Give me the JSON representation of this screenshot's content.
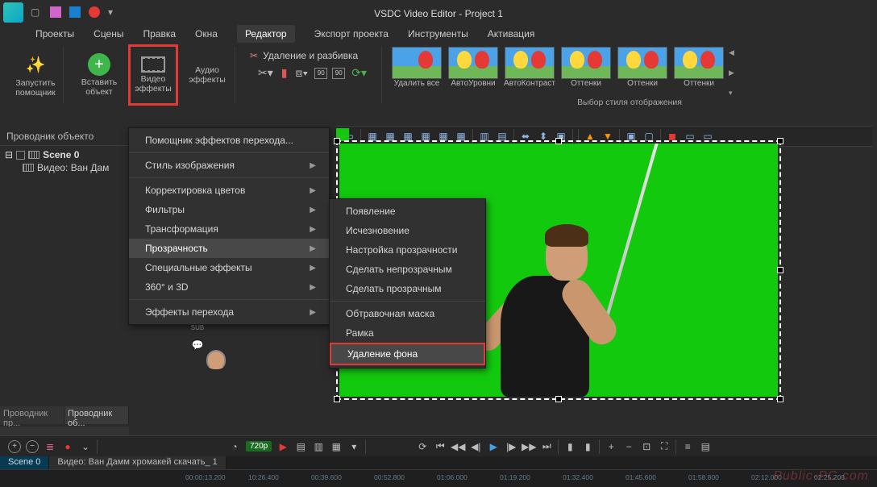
{
  "title": "VSDC Video Editor - Project 1",
  "menubar": [
    "Проекты",
    "Сцены",
    "Правка",
    "Окна",
    "Редактор",
    "Экспорт проекта",
    "Инструменты",
    "Активация"
  ],
  "active_menu_index": 4,
  "ribbon": {
    "run_wizard": "Запустить\nпомощник",
    "insert_object": "Вставить\nобъект",
    "video_effects": "Видео\nэффекты",
    "audio_effects": "Аудио\nэффекты",
    "delete_split": "Удаление и разбивка",
    "gallery_label": "Выбор стиля отображения",
    "thumbs": [
      "Удалить все",
      "АвтоУровни",
      "АвтоКонтраст",
      "Оттенки",
      "Оттенки",
      "Оттенки"
    ]
  },
  "left_panel": {
    "title": "Проводник объекто",
    "scene": "Scene 0",
    "video": "Видео: Ван Дам",
    "tabs": [
      "Проводник пр...",
      "Проводник об..."
    ],
    "active_tab": 1
  },
  "context_menu_1": [
    {
      "label": "Помощник эффектов перехода...",
      "arrow": false
    },
    {
      "sep": true
    },
    {
      "label": "Стиль изображения",
      "arrow": true
    },
    {
      "sep": true
    },
    {
      "label": "Корректировка цветов",
      "arrow": true
    },
    {
      "label": "Фильтры",
      "arrow": true
    },
    {
      "label": "Трансформация",
      "arrow": true
    },
    {
      "label": "Прозрачность",
      "arrow": true,
      "hl": true
    },
    {
      "label": "Специальные эффекты",
      "arrow": true
    },
    {
      "label": "360° и 3D",
      "arrow": true
    },
    {
      "sep": true
    },
    {
      "label": "Эффекты перехода",
      "arrow": true
    }
  ],
  "context_menu_2": [
    {
      "label": "Появление"
    },
    {
      "label": "Исчезновение"
    },
    {
      "label": "Настройка прозрачности"
    },
    {
      "label": "Сделать непрозрачным"
    },
    {
      "label": "Сделать прозрачным"
    },
    {
      "sep": true
    },
    {
      "label": "Обтравочная маска"
    },
    {
      "label": "Рамка"
    },
    {
      "label": "Удаление фона",
      "redbox": true
    }
  ],
  "transport": {
    "resolution": "720p"
  },
  "timeline": {
    "tabs": [
      "Scene 0",
      "Видео: Ван Дамм хромакей скачать_ 1"
    ],
    "ticks": [
      "00:00:13.200",
      "10:26.400",
      "00:39.600",
      "00:52.800",
      "01:06.000",
      "01:19.200",
      "01:32.400",
      "01:45.600",
      "01:58.800",
      "02:12.000",
      "02:25.200"
    ]
  },
  "watermark": "Public-PC.com"
}
